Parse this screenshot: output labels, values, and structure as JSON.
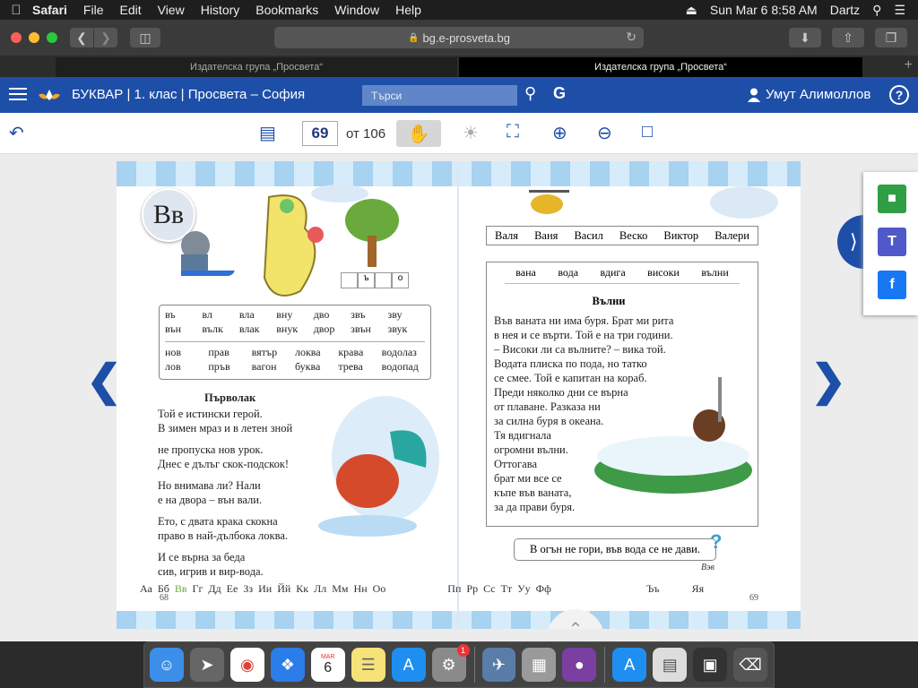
{
  "menubar": {
    "app": "Safari",
    "items": [
      "File",
      "Edit",
      "View",
      "History",
      "Bookmarks",
      "Window",
      "Help"
    ],
    "datetime": "Sun Mar 6  8:58 AM",
    "user": "Dartz"
  },
  "browser": {
    "url": "bg.e-prosveta.bg",
    "tabs": [
      "Издателска група „Просвета“",
      "Издателска група „Просвета“"
    ]
  },
  "site": {
    "title": "БУКВАР | 1. клас | Просвета – София",
    "search_placeholder": "Търси",
    "user_name": "Умут Алимоллов",
    "help": "?"
  },
  "reader": {
    "current_page": "69",
    "total_pages": "от 106"
  },
  "book": {
    "letter": "Вв",
    "letter_cursive": "Вв",
    "syllables_top": [
      [
        "въ",
        "вл",
        "вла",
        "вну",
        "дво",
        "звъ",
        "зву"
      ],
      [
        "вън",
        "вълк",
        "влак",
        "внук",
        "двор",
        "звън",
        "звук"
      ]
    ],
    "syllables_bottom": [
      [
        "нов",
        "прав",
        "вятър",
        "локва",
        "крава",
        "водолаз"
      ],
      [
        "лов",
        "пръв",
        "вагон",
        "буква",
        "трева",
        "водопад"
      ]
    ],
    "poem_title": "Първолак",
    "poem_stanzas": [
      [
        "Той е истински герой.",
        "В зимен мраз и в летен зной"
      ],
      [
        "не пропуска нов урок.",
        "Днес е дълъг скок-подскок!"
      ],
      [
        "Но внимава ли? Нали",
        "е на двора – вън вали."
      ],
      [
        "Ето, с двата крака скокна",
        "право в най-дълбока локва."
      ],
      [
        "И се върна за беда",
        "сив, игрив и вир-вода."
      ]
    ],
    "names": [
      "Валя",
      "Ваня",
      "Васил",
      "Веско",
      "Виктор",
      "Валери"
    ],
    "story_words": [
      "вана",
      "вода",
      "вдига",
      "високи",
      "вълни"
    ],
    "story_title": "Вълни",
    "story_lines": [
      "Във ваната ни има буря. Брат ми рита",
      "в нея и се върти. Той е на три години.",
      "– Високи ли са вълните? – вика той.",
      "Водата плиска по пода, но татко",
      "се смее. Той е капитан на кораб.",
      "Преди няколко дни се върна",
      "от плаване. Разказа ни",
      "за силна буря в океана.",
      "Тя вдигнала",
      "огромни вълни.",
      "Оттогава",
      "брат ми все се",
      "къпе във ваната,",
      "за да прави буря."
    ],
    "proverb": "В огън не гори, във вода се не дави.",
    "proverb_answer": "Вэв",
    "small_tiles": [
      "ъ",
      "о"
    ],
    "alphabet_left": [
      "Аа",
      "Бб",
      "Вв",
      "Гг",
      "Дд",
      "Ее",
      "Зз",
      "Ии",
      "Йй",
      "Кк",
      "Лл",
      "Мм",
      "Нн",
      "Оо"
    ],
    "alphabet_right": [
      "Пп",
      "Рр",
      "Сс",
      "Тт",
      "Уу",
      "Фф",
      "Ъъ",
      "Яя"
    ],
    "page_left": "68",
    "page_right": "69"
  },
  "dock": {
    "calendar_month": "MAR",
    "calendar_day": "6",
    "badge": "1"
  },
  "colors": {
    "brand_blue": "#1e4fa8",
    "menubar": "#1e1e1e"
  }
}
